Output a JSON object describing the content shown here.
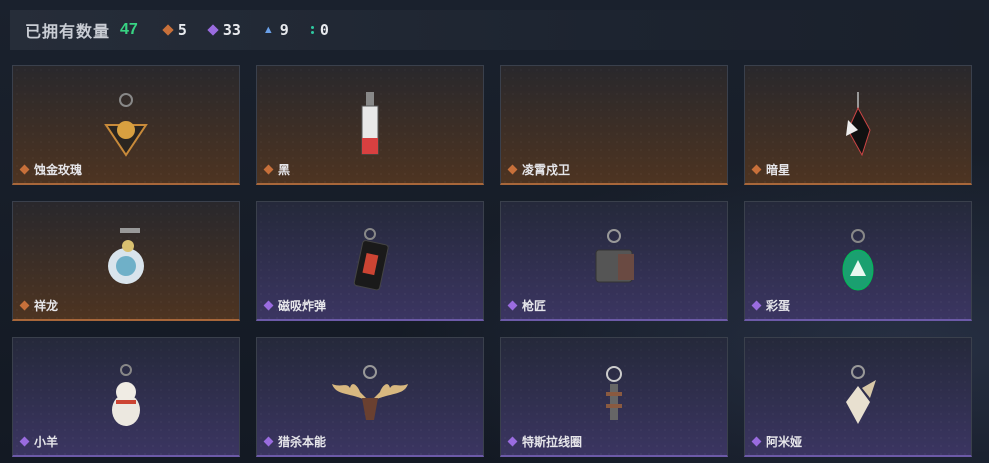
{
  "header": {
    "owned_label": "已拥有数量",
    "owned_total": "47",
    "stats": [
      {
        "icon": "orange-diamond-icon",
        "value": "5"
      },
      {
        "icon": "purple-diamond-icon",
        "value": "33"
      },
      {
        "icon": "blue-arrow-icon",
        "value": "9"
      },
      {
        "icon": "green-dots-icon",
        "value": "0"
      }
    ]
  },
  "colors": {
    "gold_rarity": "#c8703a",
    "purple_rarity": "#9a6ce0",
    "owned_total": "#38d483"
  },
  "items": [
    {
      "name": "蚀金玫瑰",
      "rarity": "gold"
    },
    {
      "name": "黑",
      "rarity": "gold"
    },
    {
      "name": "凌霄戍卫",
      "rarity": "gold"
    },
    {
      "name": "暗星",
      "rarity": "gold"
    },
    {
      "name": "祥龙",
      "rarity": "gold"
    },
    {
      "name": "磁吸炸弹",
      "rarity": "purple"
    },
    {
      "name": "枪匠",
      "rarity": "purple"
    },
    {
      "name": "彩蛋",
      "rarity": "purple"
    },
    {
      "name": "小羊",
      "rarity": "purple"
    },
    {
      "name": "猎杀本能",
      "rarity": "purple"
    },
    {
      "name": "特斯拉线圈",
      "rarity": "purple"
    },
    {
      "name": "阿米娅",
      "rarity": "purple"
    }
  ]
}
